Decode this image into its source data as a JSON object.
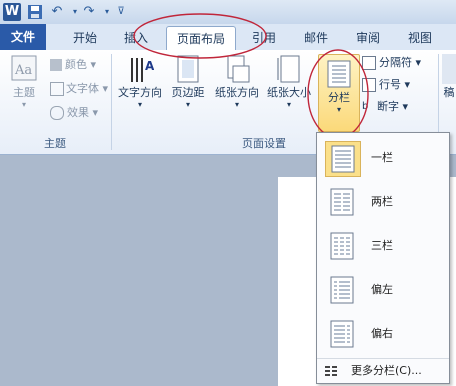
{
  "qat": {
    "app_icon": "W",
    "save_icon": "save-icon",
    "undo_icon": "undo-icon",
    "redo_icon": "redo-icon"
  },
  "tabs": {
    "file": "文件",
    "items": [
      "开始",
      "插入",
      "页面布局",
      "引用",
      "邮件",
      "审阅",
      "视图"
    ]
  },
  "ribbon": {
    "theme_group": {
      "label": "主题",
      "themes": "主题",
      "colors": "颜色",
      "fonts": "文字体",
      "effects": "效果"
    },
    "page_setup_group": {
      "label": "页面设置",
      "text_direction": "文字方向",
      "margins": "页边距",
      "orientation": "纸张方向",
      "size": "纸张大小",
      "columns": "分栏",
      "breaks": "分隔符",
      "line_numbers": "行号",
      "hyphenation": "断字"
    },
    "cut_label": "稿"
  },
  "columns_menu": {
    "items": [
      "一栏",
      "两栏",
      "三栏",
      "偏左",
      "偏右"
    ],
    "more": "更多分栏(C)..."
  },
  "colors": {
    "accent": "#2a5aa8",
    "annotation": "#c0263a",
    "highlight": "#fbe08a"
  }
}
